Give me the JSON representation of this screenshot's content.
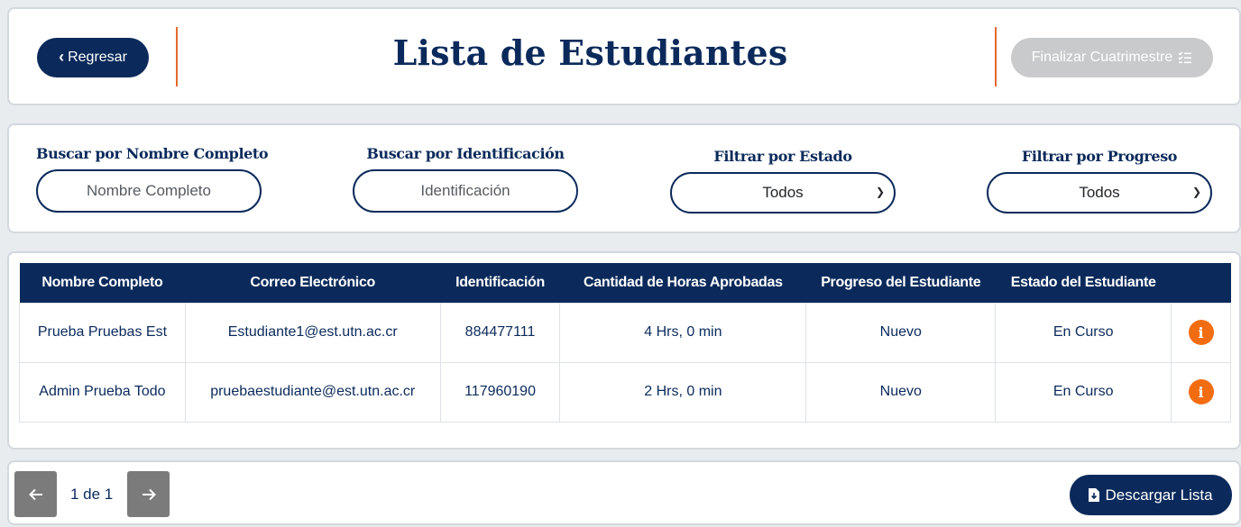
{
  "header": {
    "back_label": "Regresar",
    "title": "Lista de Estudiantes",
    "finalize_label": "Finalizar Cuatrimestre",
    "finalize_icon": "list-check-icon",
    "accent_color": "#e5692a",
    "primary_color": "#0b2a5b",
    "disabled_color": "#c9cacb"
  },
  "filters": {
    "name": {
      "label": "Buscar por Nombre Completo",
      "placeholder": "Nombre Completo"
    },
    "id": {
      "label": "Buscar por Identificación",
      "placeholder": "Identificación"
    },
    "state": {
      "label": "Filtrar por Estado",
      "value": "Todos"
    },
    "progress": {
      "label": "Filtrar por Progreso",
      "value": "Todos"
    }
  },
  "table": {
    "columns": [
      "Nombre Completo",
      "Correo Electrónico",
      "Identificación",
      "Cantidad de Horas Aprobadas",
      "Progreso del Estudiante",
      "Estado del Estudiante",
      ""
    ],
    "rows": [
      [
        "Prueba Pruebas Est",
        "Estudiante1@est.utn.ac.cr",
        "884477111",
        "4 Hrs, 0 min",
        "Nuevo",
        "En Curso"
      ],
      [
        "Admin Prueba Todo",
        "pruebaestudiante@est.utn.ac.cr",
        "117960190",
        "2 Hrs, 0 min",
        "Nuevo",
        "En Curso"
      ]
    ],
    "action_icon": "info-icon",
    "action_color": "#f26d12"
  },
  "pagination": {
    "info": "1 de 1",
    "prev_icon": "arrow-left-icon",
    "next_icon": "arrow-right-icon"
  },
  "footer": {
    "download_label": "Descargar Lista",
    "download_icon": "file-download-icon"
  }
}
